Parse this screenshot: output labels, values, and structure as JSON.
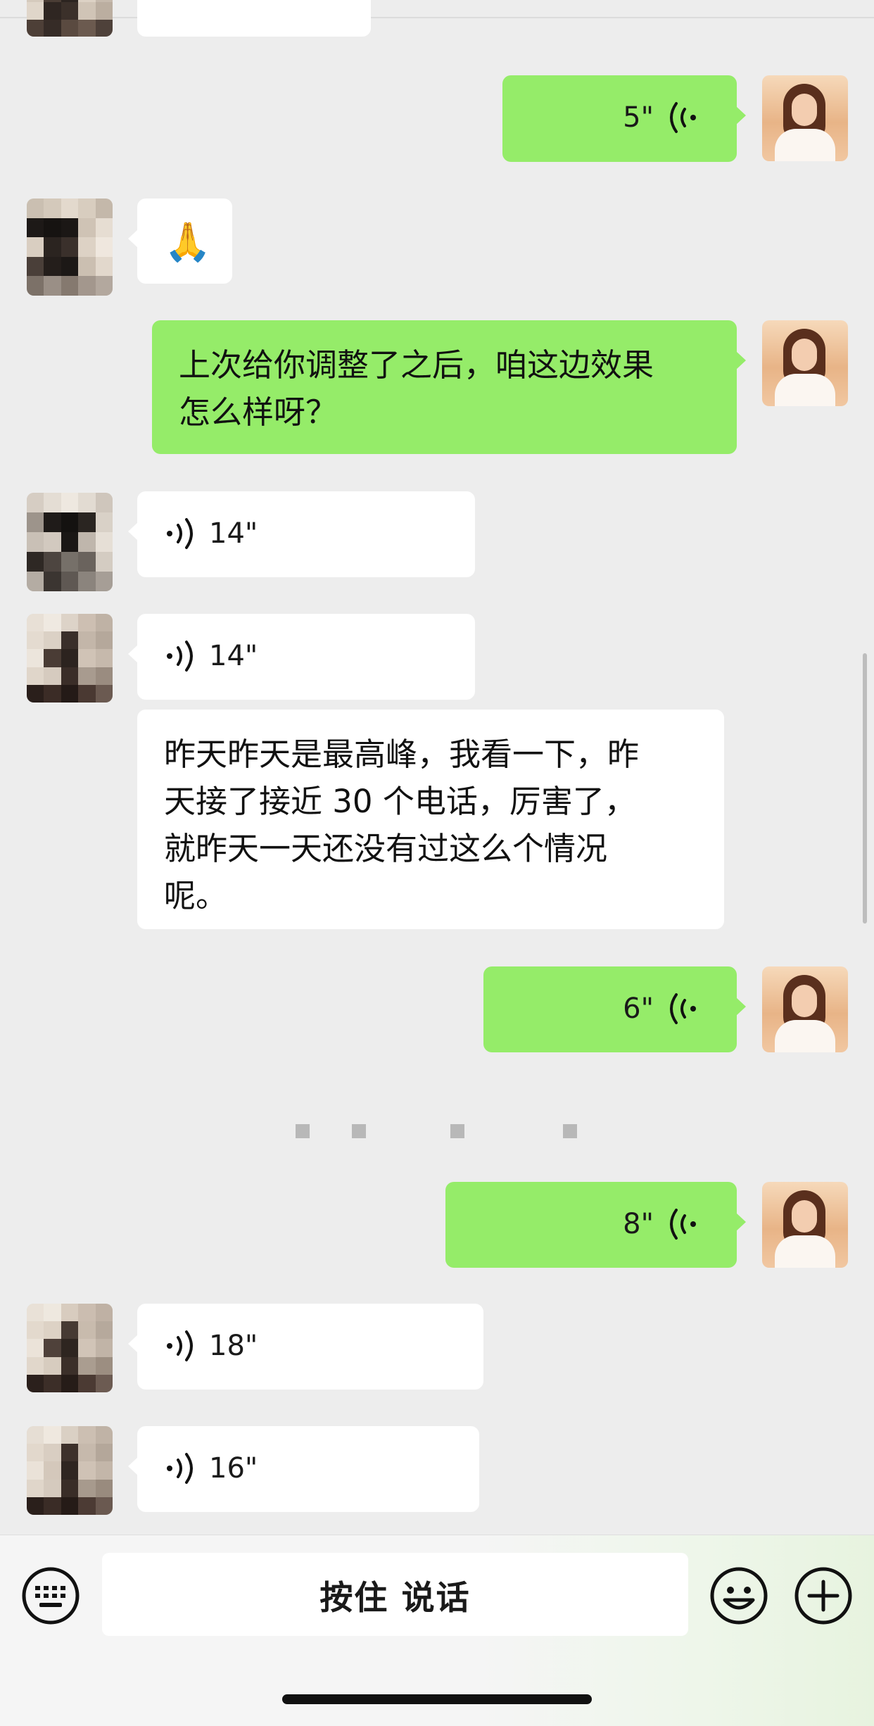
{
  "messages": {
    "out_voice_1": {
      "duration": "5\""
    },
    "peer_emoji": {
      "emoji": "🙏"
    },
    "out_text": {
      "text": "上次给你调整了之后，咱这边效果\n怎么样呀？"
    },
    "in_voice_1": {
      "duration": "14\""
    },
    "in_voice_2": {
      "duration": "14\""
    },
    "in_text": {
      "text": "昨天昨天是最高峰，我看一下，昨\n天接了接近 30 个电话，厉害了，\n就昨天一天还没有过这么个情况\n呢。"
    },
    "out_voice_2": {
      "duration": "6\""
    },
    "out_voice_3": {
      "duration": "8\""
    },
    "in_voice_3": {
      "duration": "18\""
    },
    "in_voice_4": {
      "duration": "16\""
    }
  },
  "input_bar": {
    "hold_to_talk": "按住 说话"
  },
  "colors": {
    "outgoing_bubble": "#95ec69",
    "incoming_bubble": "#ffffff",
    "background": "#ededed"
  },
  "icons": [
    "keyboard-icon",
    "emoji-icon",
    "plus-icon",
    "voice-wave-icon"
  ]
}
